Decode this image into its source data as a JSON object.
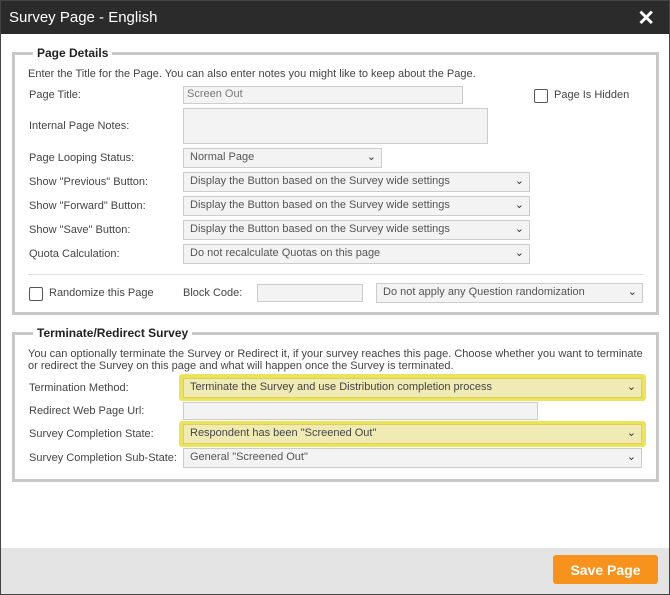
{
  "window": {
    "title": "Survey Page  -  English",
    "close_icon": "close-icon"
  },
  "page_details": {
    "legend": "Page Details",
    "hint": "Enter the Title for the Page. You can also enter notes you might like to keep about the Page.",
    "page_title_label": "Page Title:",
    "page_title_value": "Screen Out",
    "page_is_hidden_label": "Page Is Hidden",
    "page_is_hidden_checked": false,
    "internal_notes_label": "Internal Page Notes:",
    "internal_notes_value": "",
    "looping_status_label": "Page Looping Status:",
    "looping_status_value": "Normal Page",
    "previous_button_label": "Show \"Previous\" Button:",
    "previous_button_value": "Display the Button based on the Survey wide settings",
    "forward_button_label": "Show \"Forward\" Button:",
    "forward_button_value": "Display the Button based on the Survey wide settings",
    "save_button_label": "Show \"Save\" Button:",
    "save_button_value": "Display the Button based on the Survey wide settings",
    "quota_label": "Quota Calculation:",
    "quota_value": "Do not recalculate Quotas on this page",
    "randomize_label": "Randomize this Page",
    "randomize_checked": false,
    "block_code_label": "Block Code:",
    "block_code_value": "",
    "question_randomization_value": "Do not apply any Question randomization"
  },
  "terminate": {
    "legend": "Terminate/Redirect Survey",
    "hint": "You can optionally terminate the Survey or Redirect it, if your survey reaches this page. Choose whether you want to terminate or redirect the Survey on this page and what will happen once the Survey is terminated.",
    "method_label": "Termination Method:",
    "method_value": "Terminate the Survey and use Distribution completion process",
    "redirect_label": "Redirect Web Page Url:",
    "redirect_value": "",
    "completion_state_label": "Survey Completion State:",
    "completion_state_value": "Respondent has been \"Screened Out\"",
    "completion_substate_label": "Survey Completion Sub-State:",
    "completion_substate_value": "General \"Screened Out\""
  },
  "footer": {
    "save_label": "Save Page"
  },
  "colors": {
    "title_bar": "#2b2b2b",
    "highlight": "#ece35d",
    "save_button": "#f7921d"
  }
}
